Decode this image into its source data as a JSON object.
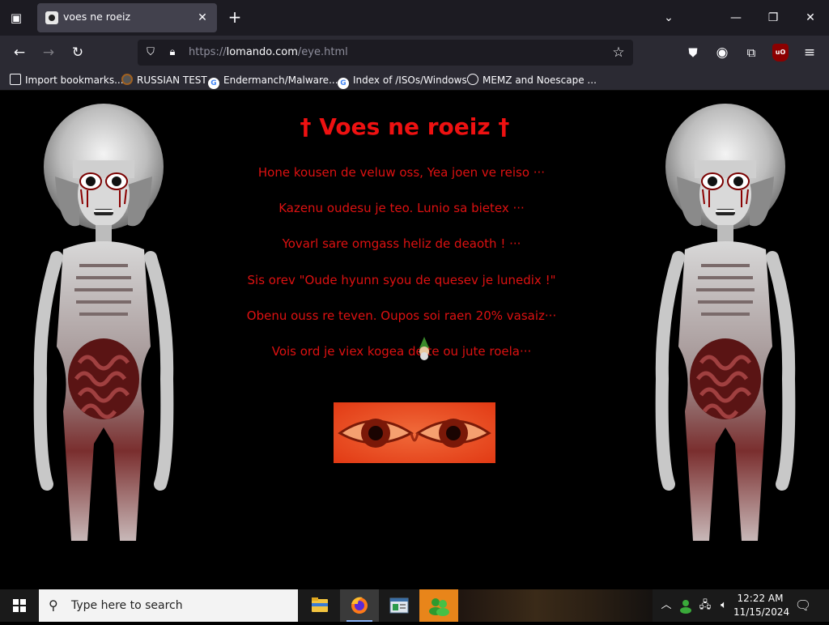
{
  "browser": {
    "tab": {
      "title": "voes ne roeiz"
    },
    "url": {
      "prefix": "https://",
      "host": "lomando.com",
      "path": "/eye.html"
    },
    "bookmarks": [
      {
        "label": "Import bookmarks..."
      },
      {
        "label": "RUSSIAN TEST"
      },
      {
        "label": "Endermanch/Malware..."
      },
      {
        "label": "Index of /ISOs/Windows"
      },
      {
        "label": "MEMZ and Noescape ..."
      }
    ],
    "extension_badge": "uO"
  },
  "page": {
    "heading": "† Voes ne roeiz †",
    "lines": [
      "Hone kousen de veluw oss, Yea joen ve reiso ···",
      "Kazenu oudesu je teo. Lunio sa bietex ···",
      "Yovarl sare omgass heliz de deaoth ! ···",
      "Sis orev \"Oude hyunn syou de quesev je lunedix !\"",
      "Obenu ouss re teven. Oupos soi raen 20% vasaiz···",
      "Vois ord je viex kogea de  te ou jute roela···"
    ],
    "colors": {
      "text": "#dd1111",
      "heading": "#ee1111",
      "background": "#000000"
    }
  },
  "taskbar": {
    "search_placeholder": "Type here to search",
    "time": "12:22 AM",
    "date": "11/15/2024"
  }
}
